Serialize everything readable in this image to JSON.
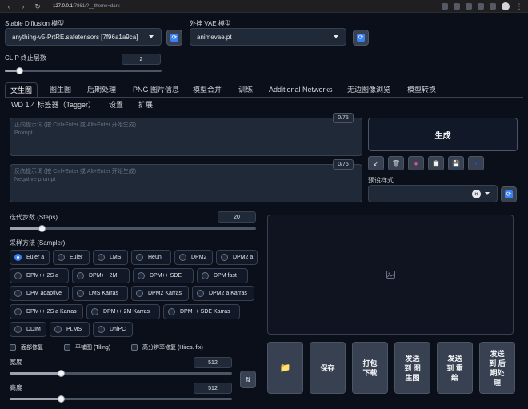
{
  "browser": {
    "url_host": "127.0.0.1",
    "url_path": ":7861/?__theme=dark"
  },
  "top": {
    "model_label": "Stable Diffusion 模型",
    "model_value": "anything-v5-PrtRE.safetensors [7f96a1a9ca]",
    "vae_label": "外挂 VAE 模型",
    "vae_value": "animevae.pt",
    "clip_label": "CLIP 终止层数",
    "clip_value": "2",
    "clip_fraction": 0.09
  },
  "tabs": [
    "文生图",
    "图生图",
    "后期处理",
    "PNG 图片信息",
    "模型合并",
    "训练",
    "Additional Networks",
    "无边图像浏览",
    "模型转换",
    "WD 1.4 标签器（Tagger）",
    "设置",
    "扩展"
  ],
  "active_tab": "文生图",
  "prompt": {
    "counter": "0/75",
    "placeholder_cn": "正向提示词 (按 Ctrl+Enter 或 Alt+Enter 开始生成)",
    "placeholder_en": "Prompt"
  },
  "negative": {
    "counter": "0/75",
    "placeholder_cn": "反向提示词 (按 Ctrl+Enter 或 Alt+Enter 开始生成)",
    "placeholder_en": "Negative prompt"
  },
  "generate_label": "生成",
  "tools": [
    {
      "icon": "arrow-icon",
      "glyph": "↙"
    },
    {
      "icon": "trash-icon",
      "glyph": "🗑"
    },
    {
      "icon": "extra-networks-icon",
      "glyph": "●"
    },
    {
      "icon": "clipboard-icon",
      "glyph": "📋"
    },
    {
      "icon": "save-style-icon",
      "glyph": "💾"
    },
    {
      "icon": "apply-style-icon",
      "glyph": "▪"
    }
  ],
  "styles_label": "预设样式",
  "steps": {
    "label": "迭代步数 (Steps)",
    "value": "20",
    "fraction": 0.13
  },
  "sampler_label": "采样方法 (Sampler)",
  "samplers": [
    "Euler a",
    "Euler",
    "LMS",
    "Heun",
    "DPM2",
    "DPM2 a",
    "DPM++ 2S a",
    "DPM++ 2M",
    "DPM++ SDE",
    "DPM fast",
    "DPM adaptive",
    "LMS Karras",
    "DPM2 Karras",
    "DPM2 a Karras",
    "DPM++ 2S a Karras",
    "DPM++ 2M Karras",
    "DPM++ SDE Karras",
    "DDIM",
    "PLMS",
    "UniPC"
  ],
  "selected_sampler": "Euler a",
  "checks": [
    "面部修复",
    "平铺图 (Tiling)",
    "高分辨率修复 (Hires. fix)"
  ],
  "width": {
    "label": "宽度",
    "value": "512",
    "fraction": 0.23
  },
  "height": {
    "label": "高度",
    "value": "512",
    "fraction": 0.23
  },
  "swap_glyph": "⇅",
  "actions": [
    {
      "name": "open-folder-button",
      "label": "📁"
    },
    {
      "name": "save-button",
      "label": "保存"
    },
    {
      "name": "zip-button",
      "label": "打包\n下载"
    },
    {
      "name": "send-to-img2img-button",
      "label": "发送\n到 图\n生图"
    },
    {
      "name": "send-to-inpaint-button",
      "label": "发送\n到 重\n绘"
    },
    {
      "name": "send-to-extras-button",
      "label": "发送\n到 后\n期处\n理"
    }
  ],
  "colors": {
    "accent": "#3b82f6",
    "background": "#0b0f19",
    "input": "#1f2937"
  }
}
